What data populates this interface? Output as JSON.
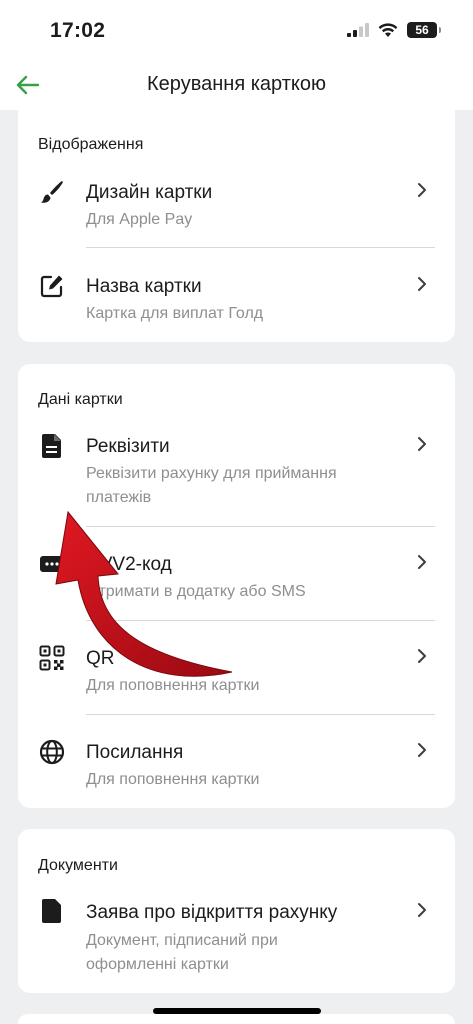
{
  "status": {
    "time": "17:02",
    "battery": "56"
  },
  "nav": {
    "title": "Керування карткою"
  },
  "display": {
    "title": "Відображення",
    "items": [
      {
        "title": "Дизайн картки",
        "subtitle": "Для Apple Pay",
        "icon": "brush-icon"
      },
      {
        "title": "Назва картки",
        "subtitle": "Картка для виплат Голд",
        "icon": "edit-icon"
      }
    ]
  },
  "card_data": {
    "title": "Дані картки",
    "items": [
      {
        "title": "Реквізити",
        "subtitle": "Реквізити рахунку для приймання платежів",
        "icon": "document-icon"
      },
      {
        "title": "CVV2-код",
        "subtitle": "Отримати в додатку або SMS",
        "icon": "password-icon"
      },
      {
        "title": "QR",
        "subtitle": "Для поповнення картки",
        "icon": "qr-code-icon"
      },
      {
        "title": "Посилання",
        "subtitle": "Для поповнення картки",
        "icon": "globe-icon"
      }
    ]
  },
  "documents": {
    "title": "Документи",
    "items": [
      {
        "title": "Заява про відкриття рахунку",
        "subtitle": "Документ, підписаний при оформленні картки",
        "icon": "document-icon"
      }
    ]
  },
  "colors": {
    "accent": "#3aa046",
    "arrow": "#c8101a",
    "background": "#eeeff1"
  }
}
